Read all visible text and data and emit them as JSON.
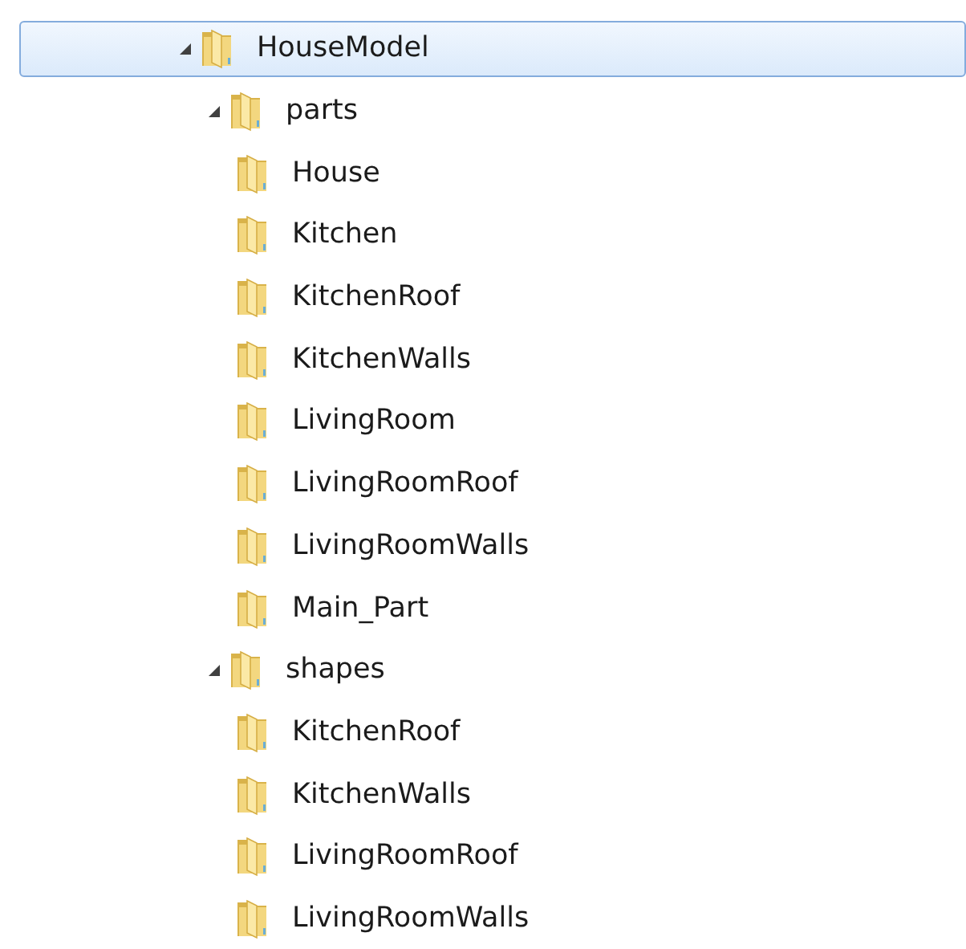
{
  "tree": [
    {
      "label": "HouseModel",
      "selected": true,
      "expanded": true,
      "children": [
        {
          "label": "parts",
          "selected": false,
          "expanded": true,
          "children": [
            {
              "label": "House",
              "selected": false
            },
            {
              "label": "Kitchen",
              "selected": false
            },
            {
              "label": "KitchenRoof",
              "selected": false
            },
            {
              "label": "KitchenWalls",
              "selected": false
            },
            {
              "label": "LivingRoom",
              "selected": false
            },
            {
              "label": "LivingRoomRoof",
              "selected": false
            },
            {
              "label": "LivingRoomWalls",
              "selected": false
            },
            {
              "label": "Main_Part",
              "selected": false
            }
          ]
        },
        {
          "label": "shapes",
          "selected": false,
          "expanded": true,
          "children": [
            {
              "label": "KitchenRoof",
              "selected": false
            },
            {
              "label": "KitchenWalls",
              "selected": false
            },
            {
              "label": "LivingRoomRoof",
              "selected": false
            },
            {
              "label": "LivingRoomWalls",
              "selected": false
            }
          ]
        }
      ]
    }
  ]
}
